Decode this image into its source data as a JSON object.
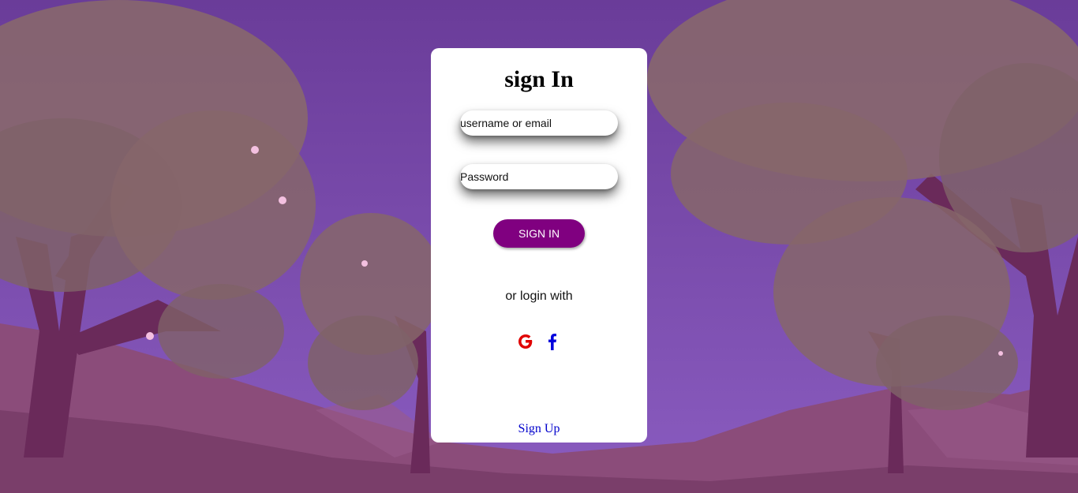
{
  "colors": {
    "sky_top": "#6a3c99",
    "sky_bottom": "#8a5cc0",
    "foliage": "#8a6a6a",
    "trunk": "#6a2a5a",
    "ground": "#8b4c7a",
    "card_bg": "#ffffff",
    "button_bg": "#800080",
    "google_red": "#e00000",
    "facebook_blue": "#0000dd",
    "link_blue": "#0000cc"
  },
  "signin_form": {
    "title": "sign In",
    "username_placeholder": "username or email",
    "password_placeholder": "Password",
    "submit_label": "SIGN IN",
    "alt_login_text": "or login with",
    "social": [
      {
        "icon": "google-icon"
      },
      {
        "icon": "facebook-icon"
      }
    ],
    "signup_link": "Sign Up"
  }
}
